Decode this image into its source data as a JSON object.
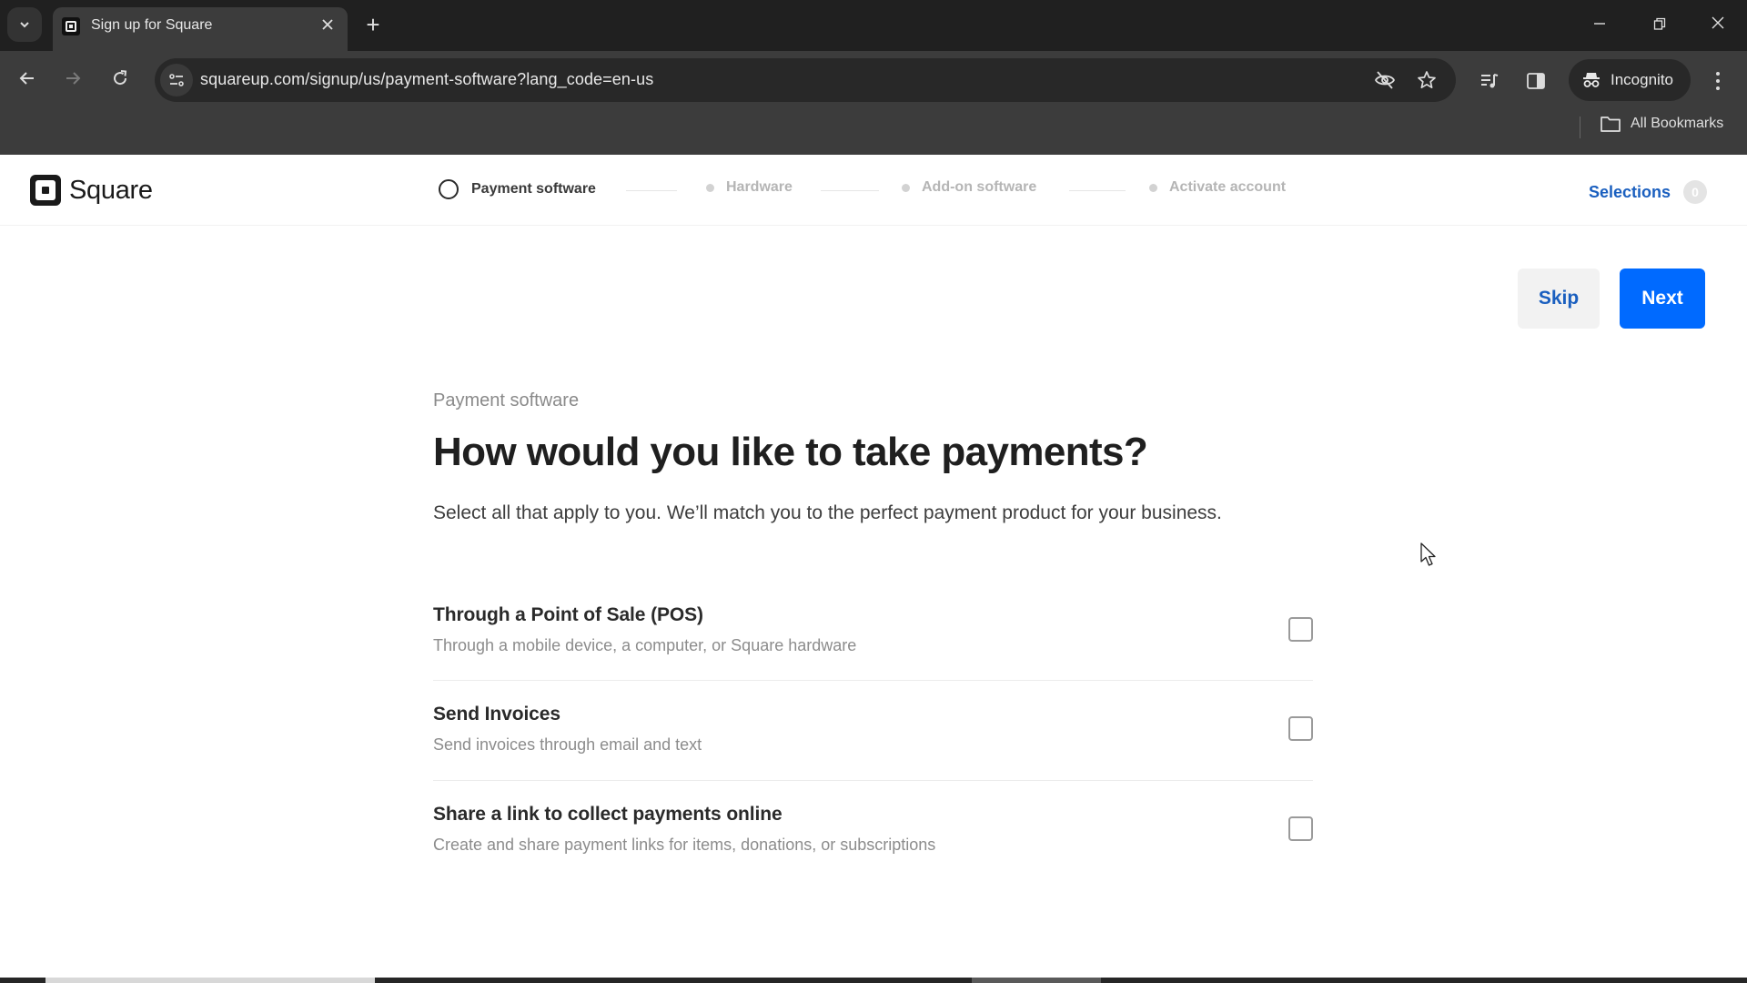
{
  "browser": {
    "tab": {
      "title": "Sign up for Square",
      "favicon": "square-logo-icon"
    },
    "new_tab_label": "+",
    "url": "squareup.com/signup/us/payment-software?lang_code=en-us",
    "profile_label": "Incognito",
    "bookmarks_label": "All Bookmarks",
    "icons": {
      "tab_search": "chevron-down-icon",
      "back": "arrow-left-icon",
      "forward": "arrow-right-icon",
      "reload": "reload-icon",
      "site_info": "tune-icon",
      "tracking": "eye-off-icon",
      "bookmark": "star-icon",
      "media": "media-control-icon",
      "side_panel": "side-panel-icon",
      "menu": "kebab-menu-icon"
    }
  },
  "header": {
    "logo_text": "Square",
    "steps": [
      {
        "label": "Payment software",
        "state": "current"
      },
      {
        "label": "Hardware",
        "state": "pending"
      },
      {
        "label": "Add-on software",
        "state": "pending"
      },
      {
        "label": "Activate account",
        "state": "pending"
      }
    ],
    "selections_label": "Selections",
    "selections_count": "0"
  },
  "actions": {
    "skip_label": "Skip",
    "next_label": "Next"
  },
  "main": {
    "eyebrow": "Payment software",
    "headline": "How would you like to take payments?",
    "subtitle": "Select all that apply to you. We’ll match you to the perfect payment product for your business.",
    "options": [
      {
        "title": "Through a Point of Sale (POS)",
        "description": "Through a mobile device, a computer, or Square hardware",
        "checked": false
      },
      {
        "title": "Send Invoices",
        "description": "Send invoices through email and text",
        "checked": false
      },
      {
        "title": "Share a link to collect payments online",
        "description": "Create and share payment links for items, donations, or subscriptions",
        "checked": false
      }
    ]
  },
  "colors": {
    "brand_blue": "#006aff",
    "link_blue": "#1a5fbf",
    "text_primary": "#1f1f1f",
    "text_muted": "#8c8c8c"
  }
}
